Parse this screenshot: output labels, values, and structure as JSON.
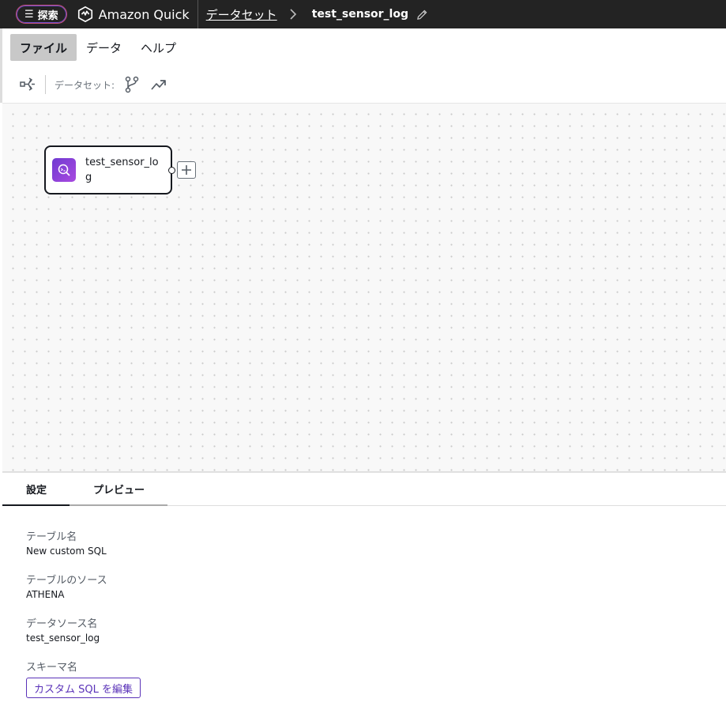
{
  "topbar": {
    "explore_label": "探索",
    "brand": "Amazon Quick",
    "breadcrumb_link": "データセット",
    "breadcrumb_current": "test_sensor_log"
  },
  "menubar": {
    "items": [
      {
        "label": "ファイル",
        "active": true
      },
      {
        "label": "データ",
        "active": false
      },
      {
        "label": "ヘルプ",
        "active": false
      }
    ]
  },
  "toolbar": {
    "dataset_label": "データセット:",
    "icons": [
      "workflow-icon",
      "branch-icon",
      "trend-icon"
    ]
  },
  "canvas": {
    "node_label": "test_sensor_log",
    "node_icon": "custom-sql-icon"
  },
  "panel": {
    "tabs": [
      {
        "label": "設定",
        "active": true
      },
      {
        "label": "プレビュー",
        "active": false
      }
    ],
    "fields": [
      {
        "label": "テーブル名",
        "value": "New custom SQL"
      },
      {
        "label": "テーブルのソース",
        "value": "ATHENA"
      },
      {
        "label": "データソース名",
        "value": "test_sensor_log"
      },
      {
        "label": "スキーマ名",
        "value": ""
      }
    ],
    "edit_sql_label": "カスタム SQL を編集"
  },
  "colors": {
    "topbar_bg": "#232323",
    "accent_purple": "#5a32b8",
    "node_icon_gradient_start": "#6f3ad1",
    "node_icon_gradient_end": "#a94ae0"
  }
}
